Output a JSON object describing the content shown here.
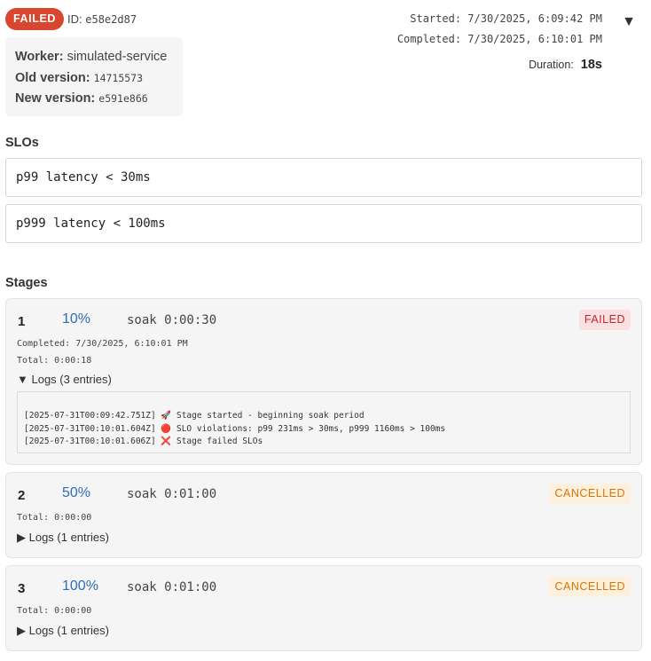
{
  "header": {
    "status": "FAILED",
    "id_label": "ID:",
    "id_value": "e58e2d87",
    "collapse_icon": "▼"
  },
  "info": {
    "worker_label": "Worker:",
    "worker_value": "simulated-service",
    "old_label": "Old version:",
    "old_value": "14715573",
    "new_label": "New version:",
    "new_value": "e591e866"
  },
  "timing": {
    "started": "Started: 7/30/2025, 6:09:42 PM",
    "completed": "Completed: 7/30/2025, 6:10:01 PM",
    "duration_label": "Duration:",
    "duration_value": "18s"
  },
  "slos": {
    "title": "SLOs",
    "items": [
      "p99 latency < 30ms",
      "p999 latency < 100ms"
    ]
  },
  "stages": {
    "title": "Stages",
    "items": [
      {
        "number": "1",
        "percent": "10%",
        "kind": "soak 0:00:30",
        "status": "FAILED",
        "completed": "Completed: 7/30/2025, 6:10:01 PM",
        "total": "Total: 0:00:18",
        "logs_label": "▼ Logs (3 entries)",
        "logs": [
          "[2025-07-31T00:09:42.751Z] 🚀 Stage started - beginning soak period",
          "[2025-07-31T00:10:01.604Z] 🔴 SLO violations: p99 231ms > 30ms, p999 1160ms > 100ms",
          "[2025-07-31T00:10:01.606Z] ❌ Stage failed SLOs"
        ]
      },
      {
        "number": "2",
        "percent": "50%",
        "kind": "soak 0:01:00",
        "status": "CANCELLED",
        "total": "Total: 0:00:00",
        "logs_label": "▶ Logs (1 entries)"
      },
      {
        "number": "3",
        "percent": "100%",
        "kind": "soak 0:01:00",
        "status": "CANCELLED",
        "total": "Total: 0:00:00",
        "logs_label": "▶ Logs (1 entries)"
      }
    ]
  },
  "colors": {
    "failed_pill": "#d9462f",
    "percent_blue": "#2f6db6",
    "failed_badge_bg": "#fae0e0",
    "failed_badge_text": "#c1272d",
    "cancelled_badge_bg": "#fdf0dc",
    "cancelled_badge_text": "#d6750a"
  }
}
